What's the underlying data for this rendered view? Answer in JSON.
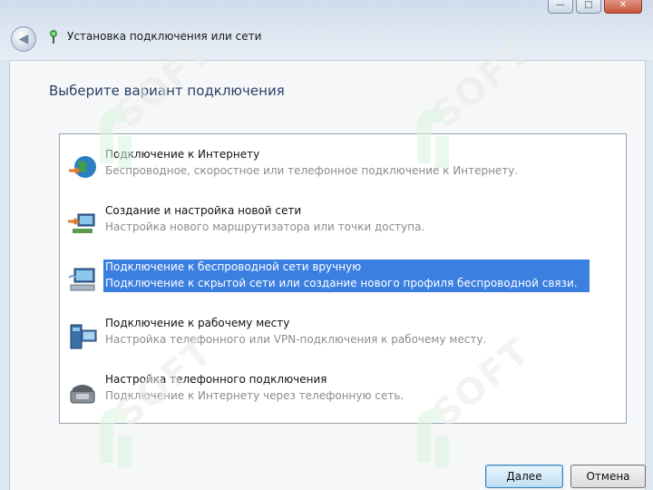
{
  "window": {
    "title": "Установка подключения или сети",
    "controls": {
      "minimize": "—",
      "maximize": "□",
      "close": "✕"
    },
    "back_icon": "back-arrow-icon"
  },
  "main": {
    "instruction": "Выберите вариант подключения",
    "options": [
      {
        "title": "Подключение к Интернету",
        "description": "Беспроводное, скоростное или телефонное подключение к Интернету.",
        "icon": "globe-icon",
        "selected": false
      },
      {
        "title": "Создание и настройка новой сети",
        "description": "Настройка нового маршрутизатора или точки доступа.",
        "icon": "network-setup-icon",
        "selected": false
      },
      {
        "title": "Подключение к беспроводной сети вручную",
        "description": "Подключение к скрытой сети или создание нового профиля беспроводной связи.",
        "icon": "wireless-network-icon",
        "selected": true
      },
      {
        "title": "Подключение к рабочему месту",
        "description": "Настройка телефонного или VPN-подключения к рабочему месту.",
        "icon": "workplace-icon",
        "selected": false
      },
      {
        "title": "Настройка телефонного подключения",
        "description": "Подключение к Интернету через телефонную сеть.",
        "icon": "dialup-phone-icon",
        "selected": false
      }
    ]
  },
  "buttons": {
    "next": "Далее",
    "cancel": "Отмена"
  },
  "watermark": {
    "text": "SOFT"
  },
  "colors": {
    "selection": "#3b7fe0",
    "instruction": "#2a3f66",
    "description": "#8c8c8c"
  }
}
